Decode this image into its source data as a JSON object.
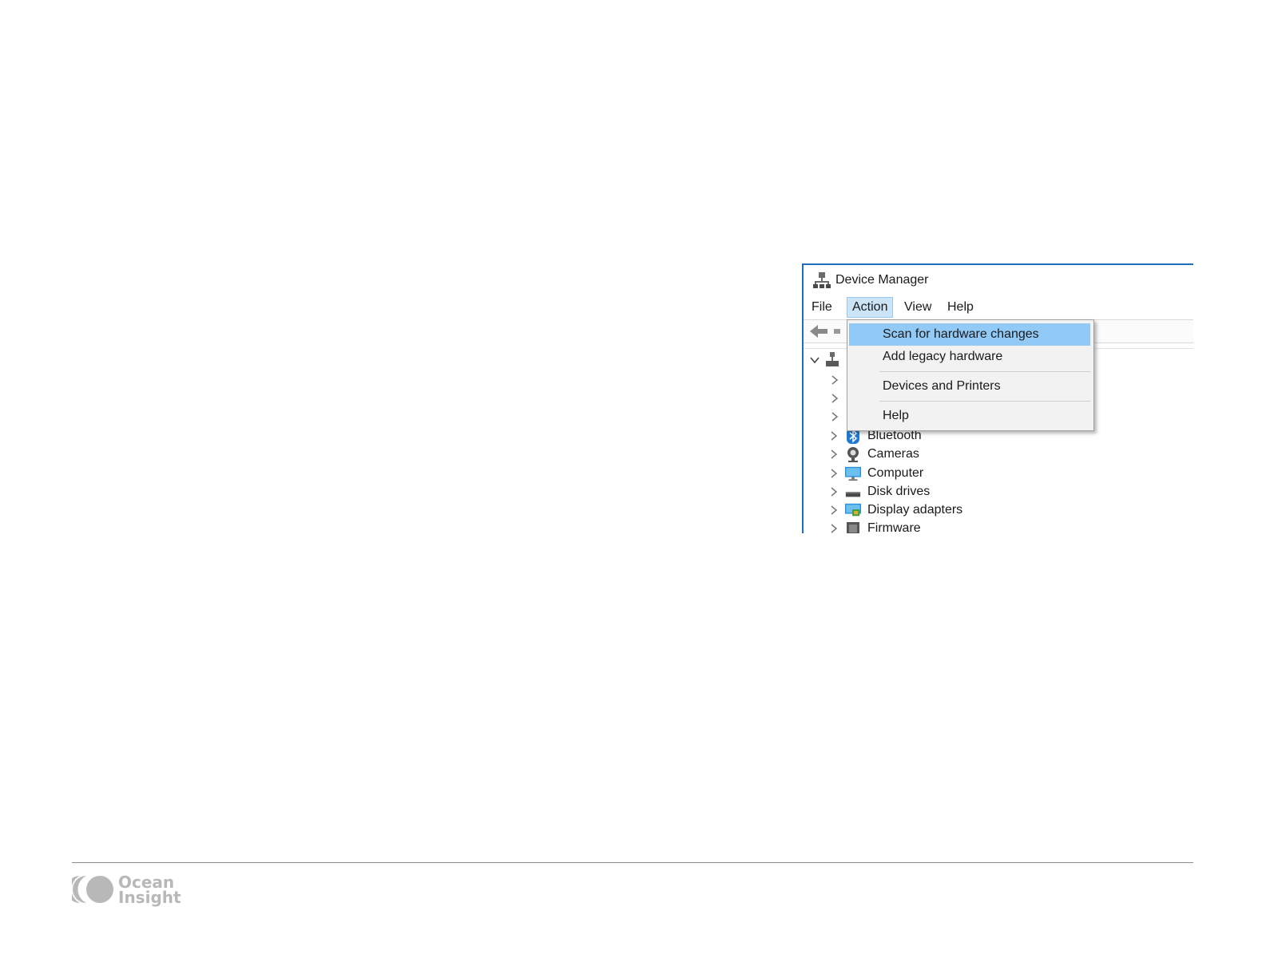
{
  "window": {
    "title": "Device Manager",
    "title_icon": "computer-tree-icon"
  },
  "menubar": {
    "items": [
      {
        "label": "File"
      },
      {
        "label": "Action",
        "active": true
      },
      {
        "label": "View"
      },
      {
        "label": "Help"
      }
    ]
  },
  "toolbar": {
    "back_icon": "back-arrow-icon"
  },
  "action_menu": {
    "items": [
      {
        "label": "Scan for hardware changes",
        "highlighted": true
      },
      {
        "label": "Add legacy hardware"
      },
      {
        "label": "Devices and Printers"
      },
      {
        "label": "Help"
      }
    ]
  },
  "tree": {
    "nodes": [
      {
        "label": "Bluetooth",
        "icon": "bluetooth-icon"
      },
      {
        "label": "Cameras",
        "icon": "camera-icon"
      },
      {
        "label": "Computer",
        "icon": "monitor-icon"
      },
      {
        "label": "Disk drives",
        "icon": "disk-drive-icon"
      },
      {
        "label": "Display adapters",
        "icon": "display-adapter-icon"
      },
      {
        "label": "Firmware",
        "icon": "firmware-icon"
      }
    ]
  },
  "footer": {
    "logo_line1": "Ocean",
    "logo_line2": "Insight",
    "logo_color": "#b8b8b8"
  },
  "colors": {
    "window_border": "#1e6fbf",
    "menu_highlight": "#91c9f7",
    "menubar_active": "#cce4f7"
  }
}
